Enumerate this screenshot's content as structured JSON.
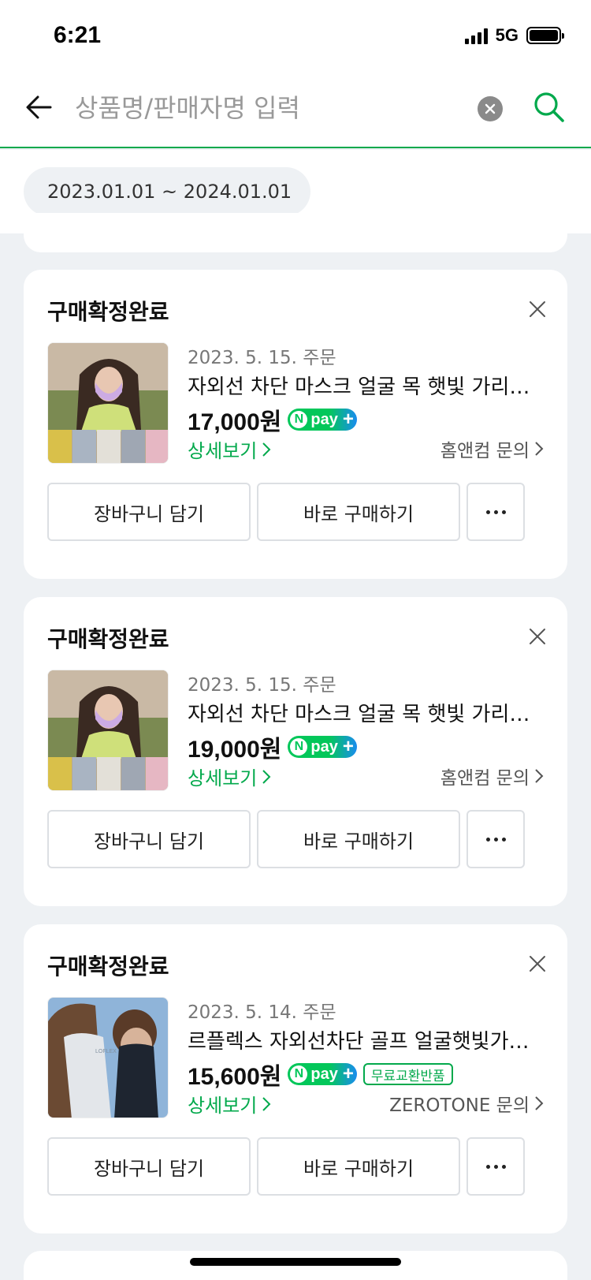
{
  "status_bar": {
    "time": "6:21",
    "network": "5G"
  },
  "search": {
    "placeholder": "상품명/판매자명 입력"
  },
  "filter": {
    "date_range": "2023.01.01 ~ 2024.01.01"
  },
  "orders": [
    {
      "status": "구매확정완료",
      "order_date": "2023. 5. 15. 주문",
      "product_name": "자외선 차단 마스크 얼굴 목 햇빛 가리개 페...",
      "price": "17,000원",
      "npay_label": "pay",
      "detail_label": "상세보기",
      "seller_label": "홈앤컴 문의",
      "cart_label": "장바구니 담기",
      "buy_label": "바로 구매하기"
    },
    {
      "status": "구매확정완료",
      "order_date": "2023. 5. 15. 주문",
      "product_name": "자외선 차단 마스크 얼굴 목 햇빛 가리개 페...",
      "price": "19,000원",
      "npay_label": "pay",
      "detail_label": "상세보기",
      "seller_label": "홈앤컴 문의",
      "cart_label": "장바구니 담기",
      "buy_label": "바로 구매하기"
    },
    {
      "status": "구매확정완료",
      "order_date": "2023. 5. 14. 주문",
      "product_name": "르플렉스 자외선차단 골프 얼굴햇빛가리개 ...",
      "price": "15,600원",
      "npay_label": "pay",
      "badge": "무료교환반품",
      "detail_label": "상세보기",
      "seller_label": "ZEROTONE 문의",
      "cart_label": "장바구니 담기",
      "buy_label": "바로 구매하기"
    }
  ],
  "colors": {
    "accent": "#03a94c",
    "npay_green": "#03c75a",
    "npay_blue": "#1a8cf0",
    "background": "#eef1f4"
  }
}
